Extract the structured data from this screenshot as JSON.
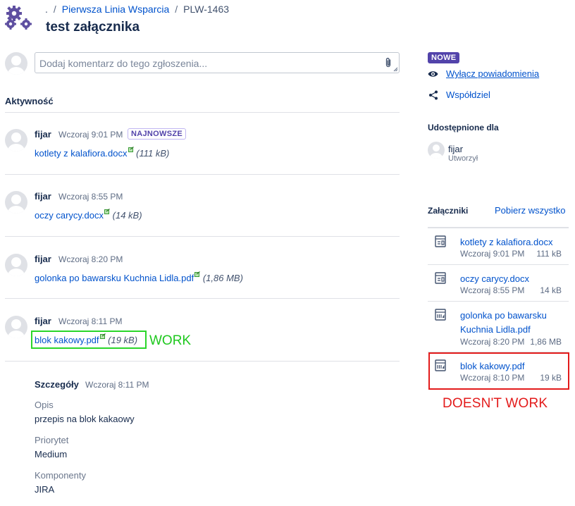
{
  "breadcrumb": {
    "project_dot": ".",
    "separator": "/",
    "project": "Pierwsza Linia Wsparcia",
    "issue_key": "PLW-1463"
  },
  "title": "test załącznika",
  "comment": {
    "placeholder": "Dodaj komentarz do tego zgłoszenia..."
  },
  "activity": {
    "heading": "Aktywność",
    "items": [
      {
        "user": "fijar",
        "time": "Wczoraj 9:01 PM",
        "badge": "NAJNOWSZE",
        "file": "kotlety z kalafiora.docx",
        "size": "(111 kB)"
      },
      {
        "user": "fijar",
        "time": "Wczoraj 8:55 PM",
        "file": "oczy carycy.docx",
        "size": "(14 kB)"
      },
      {
        "user": "fijar",
        "time": "Wczoraj 8:20 PM",
        "file": "golonka po bawarsku Kuchnia Lidla.pdf",
        "size": "(1,86 MB)"
      },
      {
        "user": "fijar",
        "time": "Wczoraj 8:11 PM",
        "file": "blok kakowy.pdf",
        "size": "(19 kB)"
      }
    ],
    "annotation_work": "WORK",
    "details": {
      "label": "Szczegóły",
      "time": "Wczoraj 8:11 PM",
      "fields": [
        {
          "label": "Opis",
          "value": "przepis na blok kakaowy"
        },
        {
          "label": "Priorytet",
          "value": "Medium"
        },
        {
          "label": "Komponenty",
          "value": "JIRA"
        }
      ]
    }
  },
  "sidebar": {
    "new_badge": "NOWE",
    "unwatch": "Wyłącz powiadomienia",
    "share": "Współdziel",
    "shared_with": {
      "heading": "Udostępnione dla",
      "name": "fijar",
      "role": "Utworzył"
    },
    "attachments": {
      "heading": "Załączniki",
      "download_all": "Pobierz wszystko",
      "items": [
        {
          "name": "kotlety z kalafiora.docx",
          "date": "Wczoraj 9:01 PM",
          "size": "111 kB",
          "icon": "document-icon"
        },
        {
          "name": "oczy carycy.docx",
          "date": "Wczoraj 8:55 PM",
          "size": "14 kB",
          "icon": "document-icon"
        },
        {
          "name": "golonka po bawarsku Kuchnia Lidla.pdf",
          "date": "Wczoraj 8:20 PM",
          "size": "1,86 MB",
          "icon": "pdf-icon"
        },
        {
          "name": "blok kakowy.pdf",
          "date": "Wczoraj 8:10 PM",
          "size": "19 kB",
          "icon": "pdf-icon"
        }
      ]
    },
    "annotation_doesnt_work": "DOESN'T WORK"
  },
  "colors": {
    "link": "#0052cc",
    "badge": "#5243aa",
    "work": "#1ec81e",
    "doesnt_work": "#e31b1b"
  }
}
